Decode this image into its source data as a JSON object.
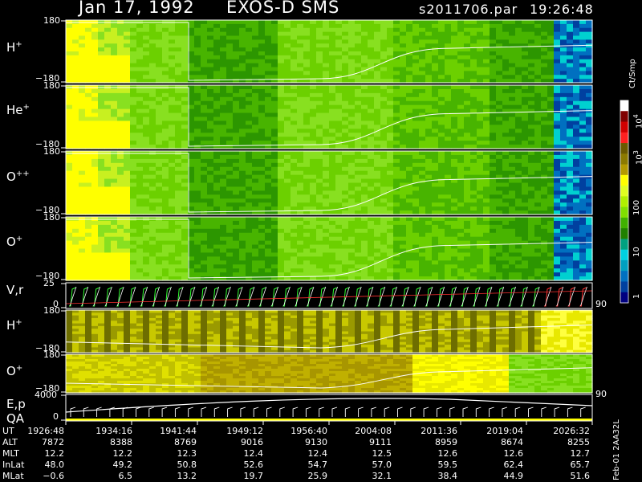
{
  "header": {
    "date": "Jan 17, 1992",
    "instrument": "EXOS-D SMS",
    "file": "s2011706.par",
    "time": "19:26:48"
  },
  "colorbar": {
    "unit": "Ct/Smp",
    "tick_labels": [
      "10",
      "100",
      "10",
      "10",
      "1"
    ],
    "exponents": [
      "4",
      "3"
    ],
    "colors": [
      "#ffffff",
      "#800000",
      "#d00000",
      "#ff2020",
      "#6b5a00",
      "#8c7a00",
      "#b49a00",
      "#ffff00",
      "#e0ff20",
      "#b0f000",
      "#80e000",
      "#40b000",
      "#208000",
      "#00a080",
      "#00d0e0",
      "#00a0c0",
      "#0070c0",
      "#0040a0",
      "#000080"
    ]
  },
  "panels": [
    {
      "label": "H",
      "sup": "+",
      "ymax": "180",
      "ymin": "−180"
    },
    {
      "label": "He",
      "sup": "+",
      "ymax": "180",
      "ymin": "−180"
    },
    {
      "label": "O",
      "sup": "++",
      "ymax": "180",
      "ymin": "−180"
    },
    {
      "label": "O",
      "sup": "+",
      "ymax": "180",
      "ymin": "−180"
    },
    {
      "label": "V,r",
      "sup": "",
      "ymax": "25",
      "ymin": "0",
      "right": "90"
    },
    {
      "label": "H",
      "sup": "+",
      "ymax": "180",
      "ymin": "−180"
    },
    {
      "label": "O",
      "sup": "+",
      "ymax": "180",
      "ymin": "−180"
    },
    {
      "label": "E,p",
      "sup": "",
      "label2": "QA",
      "ymax": "4000",
      "ymin": "0",
      "right": "90"
    }
  ],
  "side_note": "Feb-01 2AA32L",
  "ut_table": {
    "rows": [
      {
        "label": "UT",
        "values": [
          "1926:48",
          "1934:16",
          "1941:44",
          "1949:12",
          "1956:40",
          "2004:08",
          "2011:36",
          "2019:04",
          "2026:32"
        ]
      },
      {
        "label": "ALT",
        "values": [
          "7872",
          "8388",
          "8769",
          "9016",
          "9130",
          "9111",
          "8959",
          "8674",
          "8255"
        ]
      },
      {
        "label": "MLT",
        "values": [
          "12.2",
          "12.2",
          "12.3",
          "12.4",
          "12.4",
          "12.5",
          "12.6",
          "12.6",
          "12.7"
        ]
      },
      {
        "label": "InLat",
        "values": [
          "48.0",
          "49.2",
          "50.8",
          "52.6",
          "54.7",
          "57.0",
          "59.5",
          "62.4",
          "65.7"
        ]
      },
      {
        "label": "MLat",
        "values": [
          "−0.6",
          "6.5",
          "13.2",
          "19.7",
          "25.9",
          "32.1",
          "38.4",
          "44.9",
          "51.6"
        ]
      }
    ]
  },
  "chart_data": {
    "type": "heatmap",
    "x_ticks": [
      "1926:48",
      "1934:16",
      "1941:44",
      "1949:12",
      "1956:40",
      "2004:08",
      "2011:36",
      "2019:04",
      "2026:32"
    ],
    "y_range": [
      -180,
      180
    ],
    "colorbar_label": "Ct/Smp",
    "panels": [
      "H+",
      "He+",
      "O++",
      "O+",
      "V,r",
      "H+",
      "O+",
      "E,p QA"
    ]
  }
}
